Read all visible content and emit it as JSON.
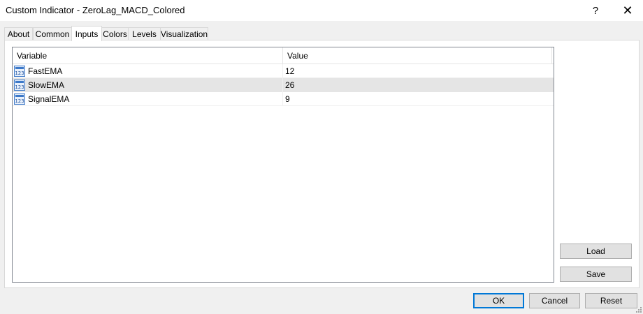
{
  "window": {
    "title": "Custom Indicator - ZeroLag_MACD_Colored",
    "help_glyph": "?",
    "close_glyph": "✕"
  },
  "tabs": [
    {
      "label": "About",
      "active": false
    },
    {
      "label": "Common",
      "active": false
    },
    {
      "label": "Inputs",
      "active": true
    },
    {
      "label": "Colors",
      "active": false
    },
    {
      "label": "Levels",
      "active": false
    },
    {
      "label": "Visualization",
      "active": false
    }
  ],
  "inputs_table": {
    "columns": [
      "Variable",
      "Value"
    ],
    "icon": "number-123-icon",
    "rows": [
      {
        "variable": "FastEMA",
        "value": "12",
        "selected": false
      },
      {
        "variable": "SlowEMA",
        "value": "26",
        "selected": true
      },
      {
        "variable": "SignalEMA",
        "value": "9",
        "selected": false
      }
    ]
  },
  "side_buttons": {
    "load": "Load",
    "save": "Save"
  },
  "footer_buttons": {
    "ok": "OK",
    "cancel": "Cancel",
    "reset": "Reset"
  },
  "colors": {
    "accent": "#0078d7",
    "selected_row": "#e5e5e5",
    "icon_blue": "#3c78c8"
  }
}
